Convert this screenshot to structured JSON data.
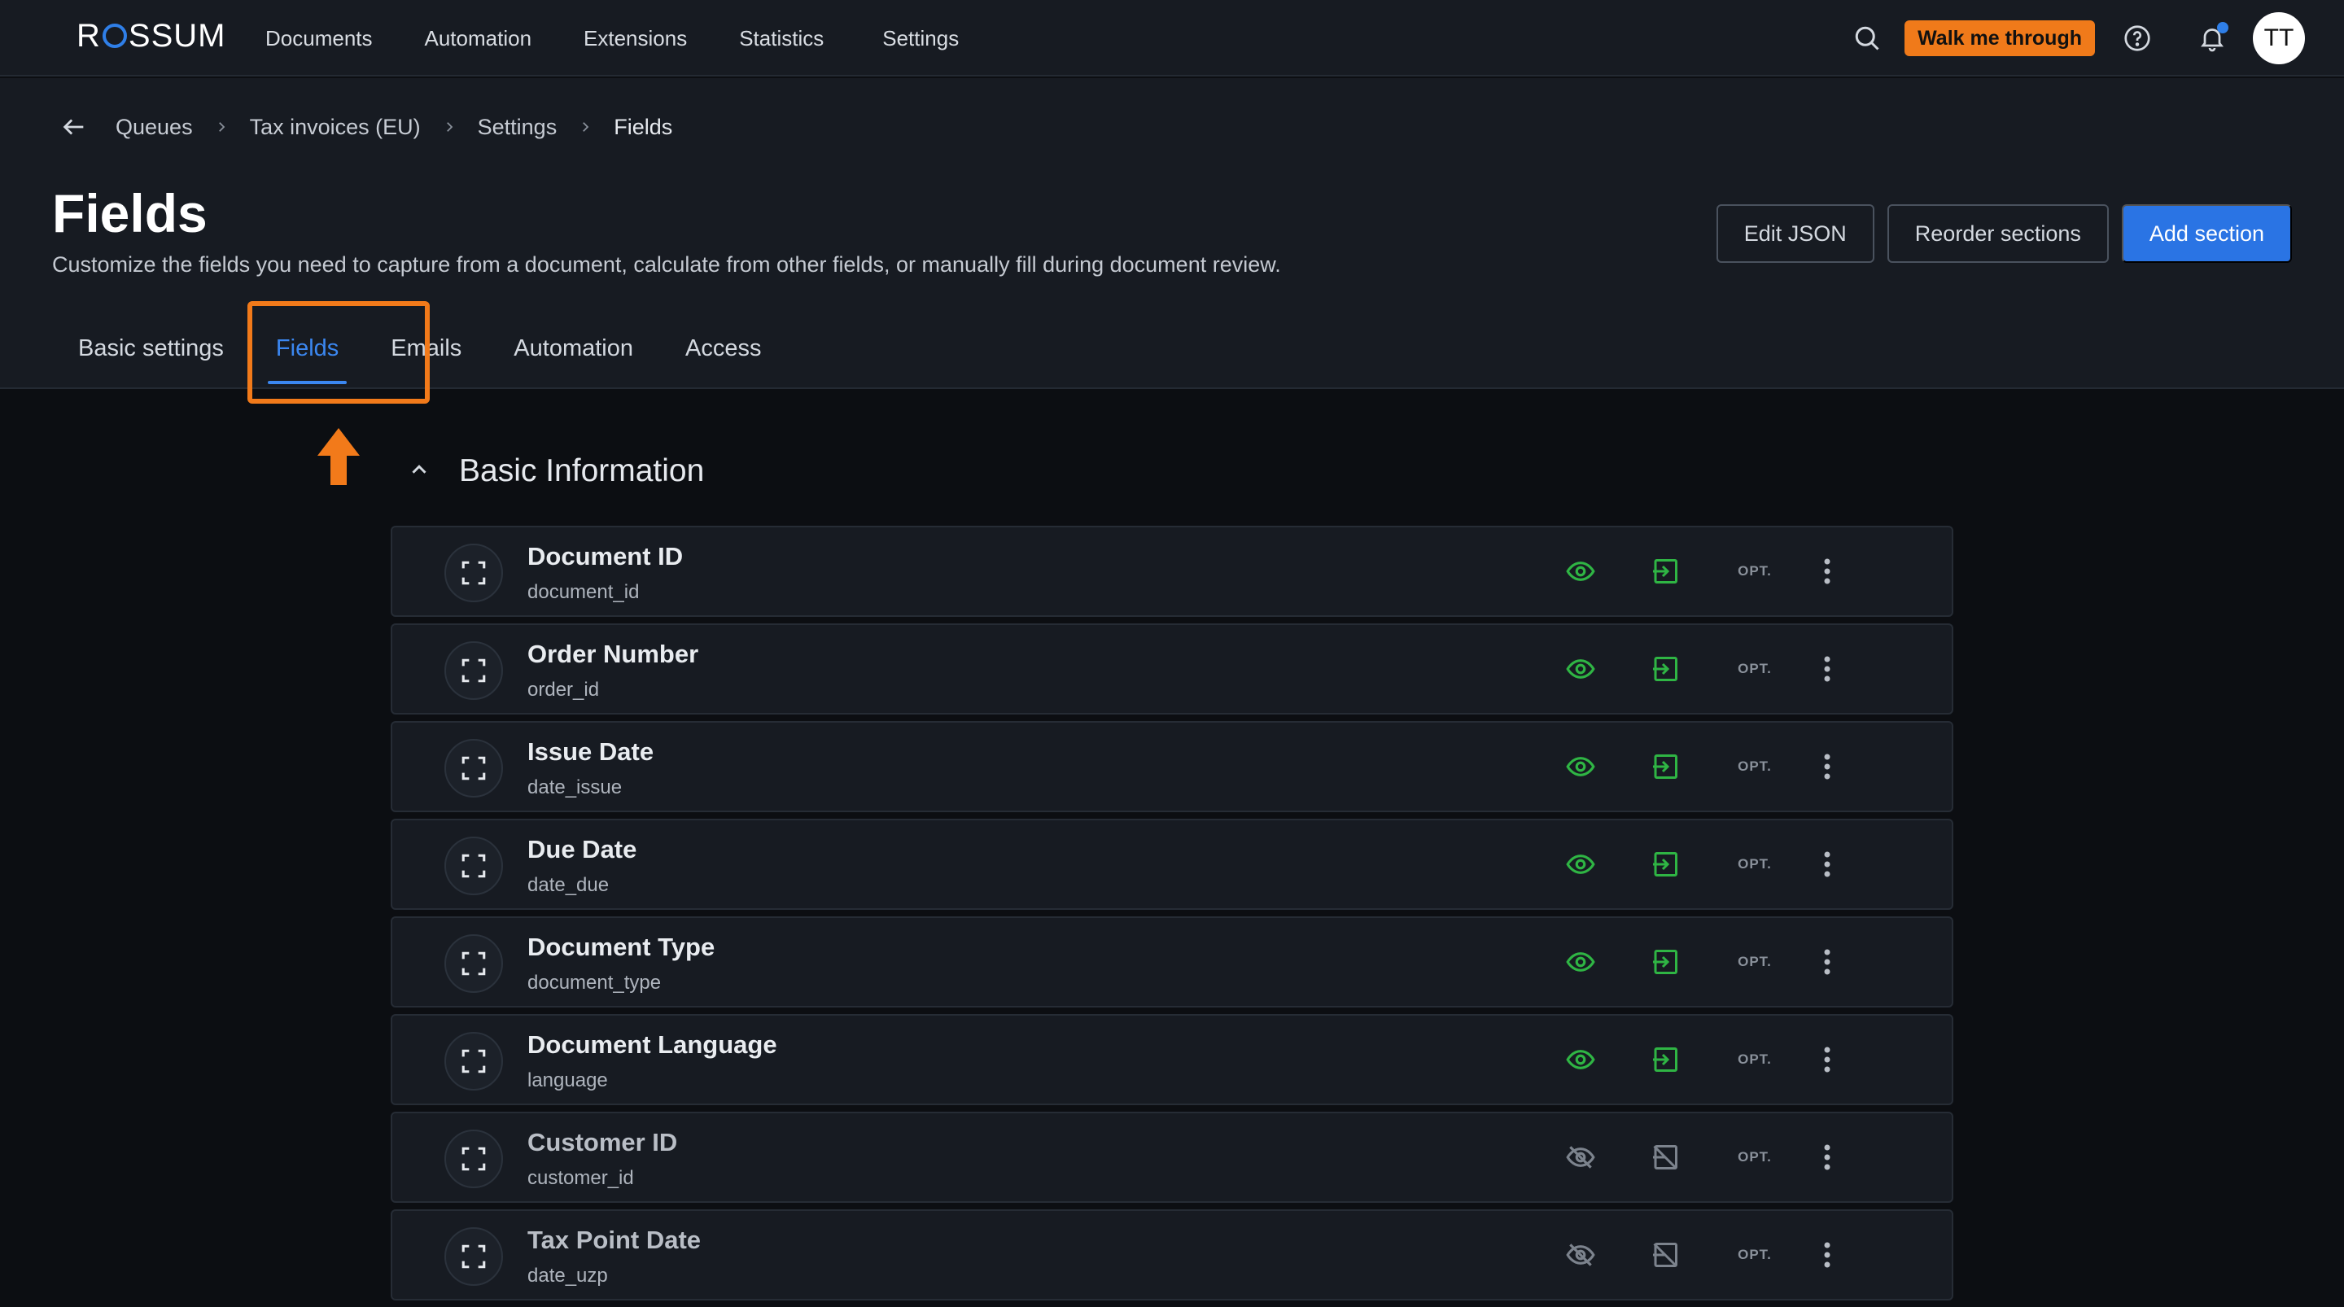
{
  "app": {
    "logo_text_before": "R",
    "logo_text_after": "SSUM",
    "nav": [
      {
        "label": "Documents"
      },
      {
        "label": "Automation"
      },
      {
        "label": "Extensions"
      },
      {
        "label": "Statistics"
      },
      {
        "label": "Settings"
      }
    ],
    "walk_me_through": "Walk me through",
    "avatar_initials": "TT"
  },
  "breadcrumb": [
    "Queues",
    "Tax invoices (EU)",
    "Settings",
    "Fields"
  ],
  "page": {
    "title": "Fields",
    "description": "Customize the fields you need to capture from a document, calculate from other fields, or manually fill during document review."
  },
  "actions": {
    "edit_json": "Edit JSON",
    "reorder_sections": "Reorder sections",
    "add_section": "Add section"
  },
  "tabs": [
    {
      "label": "Basic settings",
      "active": false
    },
    {
      "label": "Fields",
      "active": true
    },
    {
      "label": "Emails",
      "active": false
    },
    {
      "label": "Automation",
      "active": false
    },
    {
      "label": "Access",
      "active": false
    }
  ],
  "section": {
    "title": "Basic Information",
    "expanded": true
  },
  "fields": [
    {
      "label": "Document ID",
      "id": "document_id",
      "visible": true,
      "opt": "OPT."
    },
    {
      "label": "Order Number",
      "id": "order_id",
      "visible": true,
      "opt": "OPT."
    },
    {
      "label": "Issue Date",
      "id": "date_issue",
      "visible": true,
      "opt": "OPT."
    },
    {
      "label": "Due Date",
      "id": "date_due",
      "visible": true,
      "opt": "OPT."
    },
    {
      "label": "Document Type",
      "id": "document_type",
      "visible": true,
      "opt": "OPT."
    },
    {
      "label": "Document Language",
      "id": "language",
      "visible": true,
      "opt": "OPT."
    },
    {
      "label": "Customer ID",
      "id": "customer_id",
      "visible": false,
      "opt": "OPT."
    },
    {
      "label": "Tax Point Date",
      "id": "date_uzp",
      "visible": false,
      "opt": "OPT."
    }
  ],
  "colors": {
    "accent": "#2a74e4",
    "highlight": "#f27a1a",
    "visible_green": "#2fb544",
    "hidden_grey": "#7c838d"
  },
  "icons": {
    "search": "search-icon",
    "help": "help-icon",
    "bell": "bell-icon",
    "back": "arrow-left-icon",
    "chevron": "chevron-right-icon",
    "collapse": "chevron-up-icon",
    "capture": "capture-frame-icon",
    "eye": "eye-icon",
    "eye_off": "eye-off-icon",
    "editable": "enter-icon",
    "not_editable": "no-edit-icon",
    "more": "kebab-icon"
  }
}
